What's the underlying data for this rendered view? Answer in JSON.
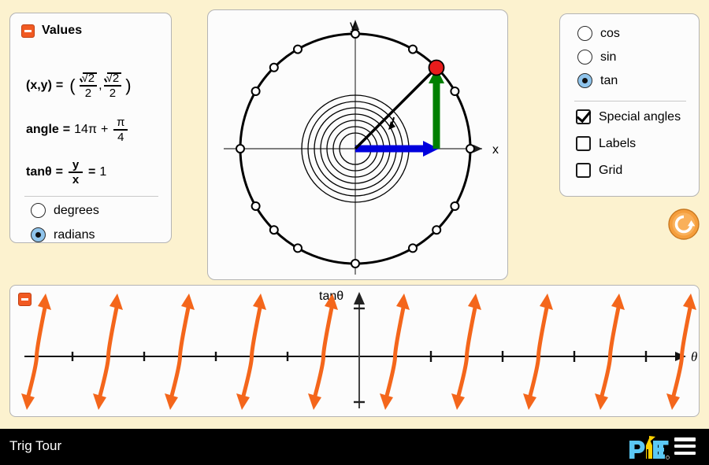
{
  "app": {
    "background_color": "#FCF2CF",
    "title": "Trig Tour",
    "logo_text": "PhET",
    "logo_colors": {
      "p_e_t": "#5BC8F5",
      "h": "#FFD200"
    }
  },
  "values_panel": {
    "title": "Values",
    "collapse_icon": "minus-icon",
    "xy_label": "(x,y)",
    "equals": "=",
    "open_paren": "(",
    "comma": ",",
    "close_paren": ")",
    "x_value": {
      "numerator": "√2",
      "denominator": "2"
    },
    "y_value": {
      "numerator": "√2",
      "denominator": "2"
    },
    "angle_label": "angle",
    "angle_whole": "14π",
    "angle_plus": "+",
    "angle_fraction": {
      "numerator": "π",
      "denominator": "4"
    },
    "tan_label": "tanθ",
    "tan_fraction": {
      "numerator": "y",
      "denominator": "x"
    },
    "tan_value": "1",
    "units": [
      {
        "label": "degrees",
        "selected": false
      },
      {
        "label": "radians",
        "selected": true
      }
    ]
  },
  "controls_panel": {
    "functions": [
      {
        "label": "cos",
        "selected": false
      },
      {
        "label": "sin",
        "selected": false
      },
      {
        "label": "tan",
        "selected": true
      }
    ],
    "checkboxes": [
      {
        "label": "Special angles",
        "checked": true
      },
      {
        "label": "Labels",
        "checked": false
      },
      {
        "label": "Grid",
        "checked": false
      }
    ]
  },
  "reset_button": {
    "icon": "reset-all-icon",
    "color": "#F5A13C"
  },
  "unit_circle": {
    "x_axis_label": "x",
    "y_axis_label": "y",
    "radius_px": 146,
    "point_angle_deg": 45,
    "point_color": "#E81C1C",
    "cos_arrow_color": "#0000DD",
    "sin_arrow_color": "#008000",
    "special_angle_count": 16,
    "spiral_turns": 7,
    "cos_value": 0.7071,
    "sin_value": 0.7071
  },
  "graph_panel": {
    "collapse_icon": "minus-icon",
    "y_axis_label": "tanθ",
    "x_axis_label": "θ",
    "curve_color": "#F4661B",
    "chart_data": {
      "type": "line",
      "title": "",
      "xlabel": "θ",
      "ylabel": "tanθ",
      "xlim": [
        -15.708,
        15.708
      ],
      "ylim": [
        -3.2,
        3.2
      ],
      "grid": false,
      "legend": null,
      "tick_step_pi": 0.5,
      "branch_centers_pi": [
        -4,
        -3,
        -2,
        -1,
        0,
        1,
        2,
        3,
        4
      ],
      "asymptotes_pi": [
        -4.5,
        -3.5,
        -2.5,
        -1.5,
        -0.5,
        0.5,
        1.5,
        2.5,
        3.5,
        4.5
      ],
      "series": [
        {
          "name": "tanθ",
          "function": "tan",
          "color": "#F4661B"
        }
      ]
    }
  }
}
